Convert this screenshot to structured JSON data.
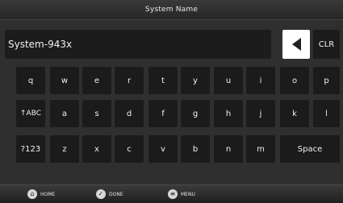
{
  "title": "System Name",
  "input": {
    "value": "System-943x"
  },
  "controls": {
    "backspace_icon": "left-triangle",
    "clear_label": "CLR"
  },
  "keyboard": {
    "row1": [
      "q",
      "w",
      "e",
      "r",
      "t",
      "y",
      "u",
      "i",
      "o",
      "p"
    ],
    "row2": [
      "↑ABC",
      "a",
      "s",
      "d",
      "f",
      "g",
      "h",
      "j",
      "k",
      "l"
    ],
    "row3": [
      "?123",
      "z",
      "x",
      "c",
      "v",
      "b",
      "n",
      "m"
    ],
    "space_label": "Space"
  },
  "bottom_bar": {
    "home": {
      "label": "HOME",
      "icon": "home-icon"
    },
    "done": {
      "label": "DONE",
      "icon": "check-icon"
    },
    "menu": {
      "label": "MENU",
      "icon": "menu-icon"
    }
  }
}
